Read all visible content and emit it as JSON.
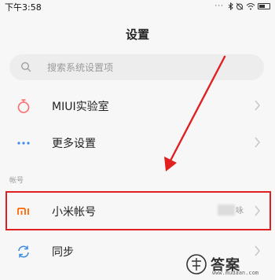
{
  "status_bar": {
    "time": "下午3:58",
    "icons": [
      "dots-icon",
      "bluetooth-icon",
      "alarm-icon",
      "wifi-icon",
      "battery-icon"
    ],
    "battery_level": 0.55
  },
  "header": {
    "title": "设置"
  },
  "search": {
    "placeholder": "搜索系统设置项"
  },
  "rows": [
    {
      "label": "MIUI实验室",
      "icon": "flask-icon",
      "icon_color": "#ff6b6b"
    },
    {
      "label": "更多设置",
      "icon": "more-dots-icon",
      "icon_color": "#3b8be8"
    }
  ],
  "section": {
    "label": "帐号"
  },
  "account_row": {
    "label": "小米帐号",
    "icon": "mi-logo-icon",
    "icon_color": "#ff6700",
    "value_suffix": "咏"
  },
  "sync_row": {
    "label": "同步",
    "icon": "sync-icon",
    "icon_color": "#3b8be8"
  },
  "annotation": {
    "highlight_color": "#e02020"
  },
  "watermark": {
    "text": "答案",
    "url": "www.mudaan.com"
  }
}
